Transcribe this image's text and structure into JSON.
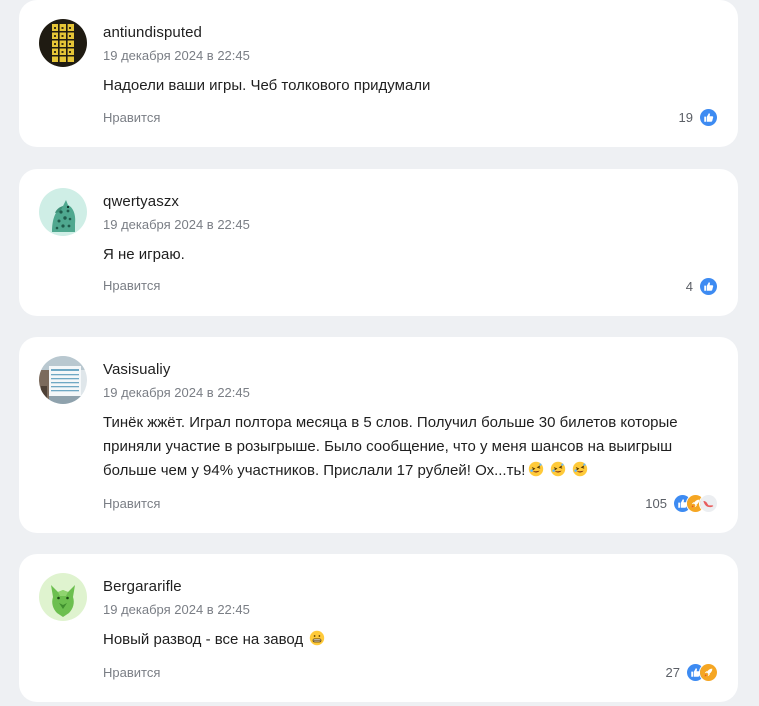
{
  "comments": [
    {
      "username": "antiundisputed",
      "date": "19 декабря 2024 в 22:45",
      "text": "Надоели ваши игры. Чеб толкового придумали",
      "like_label": "Нравится",
      "count": "19",
      "reactions": [
        "like-icon"
      ]
    },
    {
      "username": "qwertyaszx",
      "date": "19 декабря 2024 в 22:45",
      "text": "Я не играю.",
      "like_label": "Нравится",
      "count": "4",
      "reactions": [
        "like-icon"
      ]
    },
    {
      "username": "Vasisualiy",
      "date": "19 декабря 2024 в 22:45",
      "text": "Тинёк жжёт. Играл полтора месяца в 5 слов. Получил больше 30 билетов которые приняли участие в розыгрыше. Было сообщение, что у меня шансов на выигрыш больше чем у 94% участников. Прислали 17 рублей! Ох...ть!",
      "emojis": [
        "rofl-emoji",
        "rofl-emoji",
        "rofl-emoji"
      ],
      "like_label": "Нравится",
      "count": "105",
      "reactions": [
        "like-icon",
        "rocket-icon",
        "dislike-icon"
      ]
    },
    {
      "username": "Bergararifle",
      "date": "19 декабря 2024 в 22:45",
      "text": "Новый развод - все на завод",
      "emojis": [
        "grimace-emoji"
      ],
      "like_label": "Нравится",
      "count": "27",
      "reactions": [
        "like-icon",
        "rocket-icon"
      ]
    }
  ],
  "colors": {
    "like": "#3d8bf2",
    "rocket": "#f5a623",
    "dislike": "#e85d5d",
    "muted": "#7a7e85"
  }
}
